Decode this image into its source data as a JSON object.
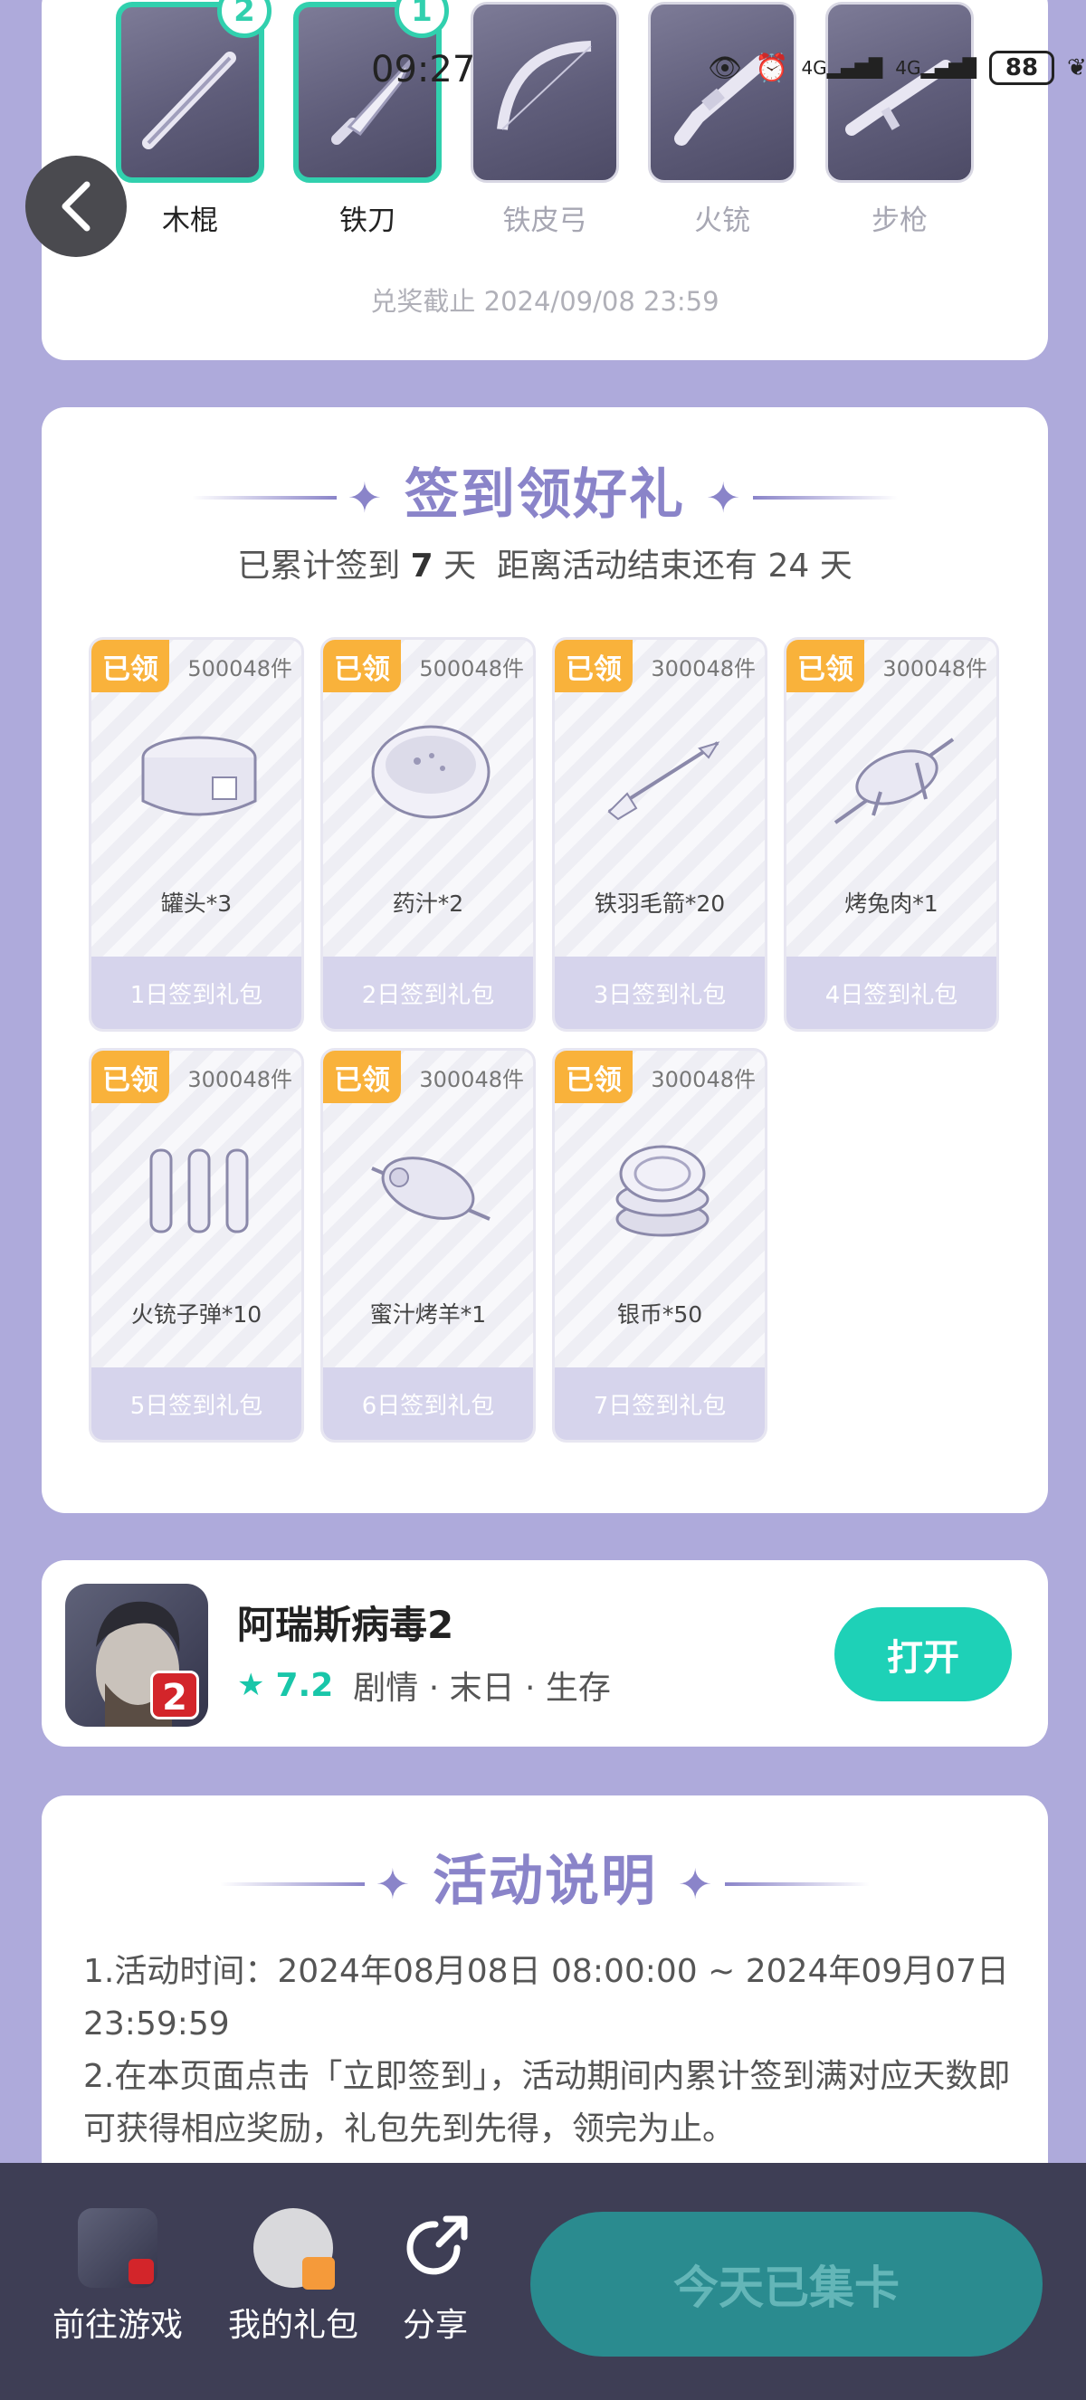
{
  "status_bar": {
    "time": "09:27",
    "network_1": "4G",
    "network_2": "4G",
    "battery": "88"
  },
  "exchange": {
    "weapons": [
      {
        "name": "木棍",
        "count": "2",
        "selected": true,
        "icon": "wooden-stick-icon"
      },
      {
        "name": "铁刀",
        "count": "1",
        "selected": true,
        "icon": "iron-knife-icon"
      },
      {
        "name": "铁皮弓",
        "count": "",
        "selected": false,
        "icon": "iron-bow-icon"
      },
      {
        "name": "火铳",
        "count": "",
        "selected": false,
        "icon": "musket-icon"
      },
      {
        "name": "步枪",
        "count": "",
        "selected": false,
        "icon": "rifle-icon"
      }
    ],
    "deadline": "兑奖截止 2024/09/08 23:59"
  },
  "checkin": {
    "title": "签到领好礼",
    "summary_prefix": "已累计签到",
    "days_signed": "7",
    "summary_mid": "天  距离活动结束还有",
    "days_left": "24",
    "summary_suffix": "天",
    "rewards": [
      {
        "badge": "已领",
        "stock": "500048件",
        "item": "罐头*3",
        "day": "1日签到礼包",
        "icon": "canned-food-icon"
      },
      {
        "badge": "已领",
        "stock": "500048件",
        "item": "药汁*2",
        "day": "2日签到礼包",
        "icon": "medicine-bowl-icon"
      },
      {
        "badge": "已领",
        "stock": "300048件",
        "item": "铁羽毛箭*20",
        "day": "3日签到礼包",
        "icon": "arrow-icon"
      },
      {
        "badge": "已领",
        "stock": "300048件",
        "item": "烤兔肉*1",
        "day": "4日签到礼包",
        "icon": "roast-rabbit-icon"
      },
      {
        "badge": "已领",
        "stock": "300048件",
        "item": "火铳子弹*10",
        "day": "5日签到礼包",
        "icon": "bullets-icon"
      },
      {
        "badge": "已领",
        "stock": "300048件",
        "item": "蜜汁烤羊*1",
        "day": "6日签到礼包",
        "icon": "roast-lamb-icon"
      },
      {
        "badge": "已领",
        "stock": "300048件",
        "item": "银币*50",
        "day": "7日签到礼包",
        "icon": "silver-coins-icon"
      }
    ]
  },
  "game": {
    "title": "阿瑞斯病毒2",
    "rating": "7.2",
    "tags": "剧情 · 末日 · 生存",
    "open_label": "打开",
    "icon_badge": "2"
  },
  "rules": {
    "title": "活动说明",
    "line1": "1.活动时间：2024年08月08日 08:00:00 ~ 2024年09月07日 23:59:59",
    "line2": "2.在本页面点击「立即签到」，活动期间内累计签到满对应天数即可获得相应奖励，礼包先到先得，领完为止。"
  },
  "bottom_bar": {
    "tab_game": "前往游戏",
    "tab_gifts": "我的礼包",
    "tab_share": "分享",
    "cta": "今天已集卡"
  },
  "colors": {
    "page_bg": "#aeaadb",
    "accent_teal": "#1ed1b7",
    "title_purple": "#8a84c9",
    "badge_orange": "#f9b23b",
    "bottom_bar": "#3e3e55",
    "cta_bg": "#2a8b8f"
  }
}
